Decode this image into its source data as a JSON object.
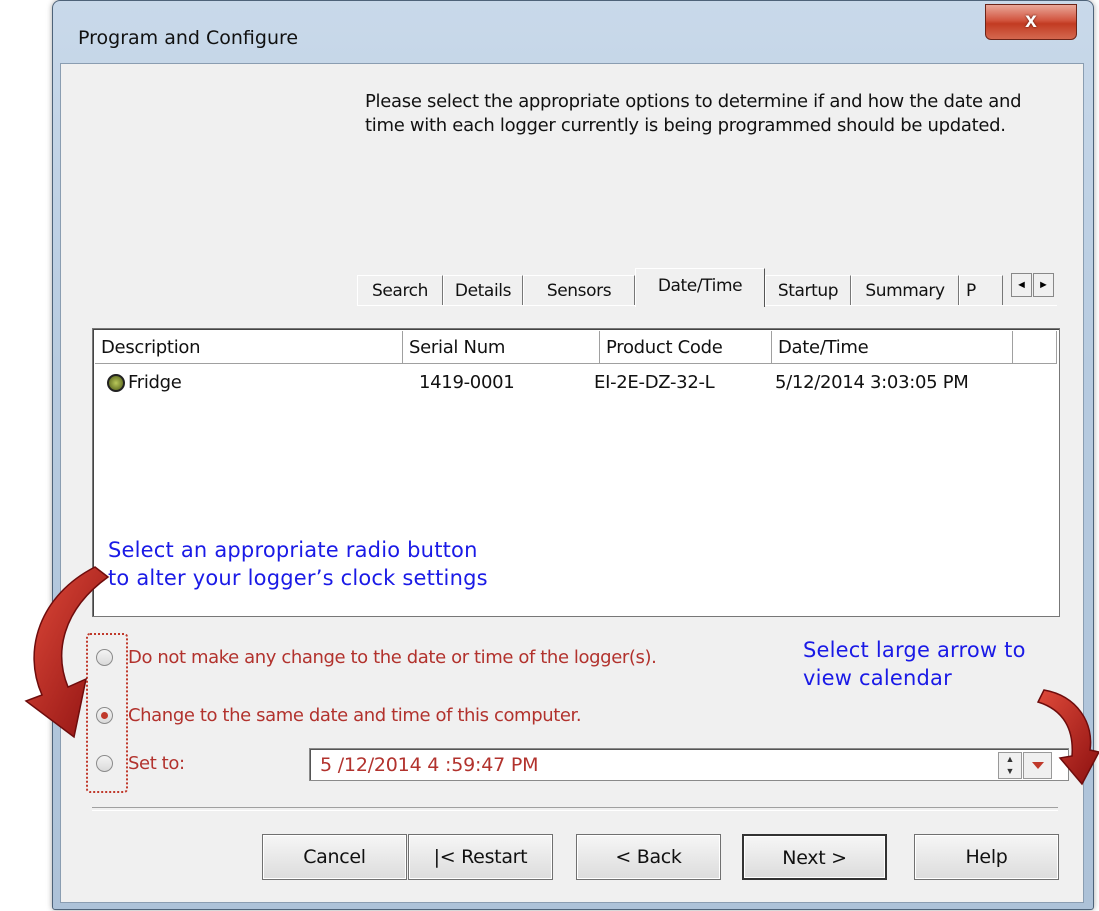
{
  "window": {
    "title": "Program and Configure",
    "close_glyph": "x"
  },
  "intro_text": "Please select the appropriate options to determine if and how the date and time with each logger currently is being programmed should be updated.",
  "tabs": [
    {
      "label": "Search"
    },
    {
      "label": "Details"
    },
    {
      "label": "Sensors"
    },
    {
      "label": "Date/Time",
      "active": true
    },
    {
      "label": "Startup"
    },
    {
      "label": "Summary"
    },
    {
      "label": "P"
    }
  ],
  "tab_scroll": {
    "left": "◄",
    "right": "►"
  },
  "list": {
    "columns": [
      "Description",
      "Serial Num",
      "Product Code",
      "Date/Time"
    ],
    "rows": [
      {
        "description": "Fridge",
        "serial": "1419-0001",
        "product_code": "EI-2E-DZ-32-L",
        "datetime": "5/12/2014 3:03:05 PM"
      }
    ]
  },
  "options": {
    "no_change": "Do not make any change to the date or time of the logger(s).",
    "same_as_computer": "Change to the same date and time of this computer.",
    "set_to": "Set to:",
    "selected": "same_as_computer"
  },
  "set_to_value": "5 /12/2014   4 :59:47 PM",
  "buttons": {
    "cancel": "Cancel",
    "restart": "|< Restart",
    "back": "< Back",
    "next": "Next >",
    "help": "Help"
  },
  "annotations": {
    "radio_line1": "Select an appropriate radio button",
    "radio_line2": "to alter your logger’s clock settings",
    "arrow_line1": "Select large arrow to",
    "arrow_line2": "view calendar"
  },
  "colors": {
    "annotation_text": "#1a1ae6",
    "option_text": "#b2322d",
    "arrow": "#b01c1c"
  }
}
